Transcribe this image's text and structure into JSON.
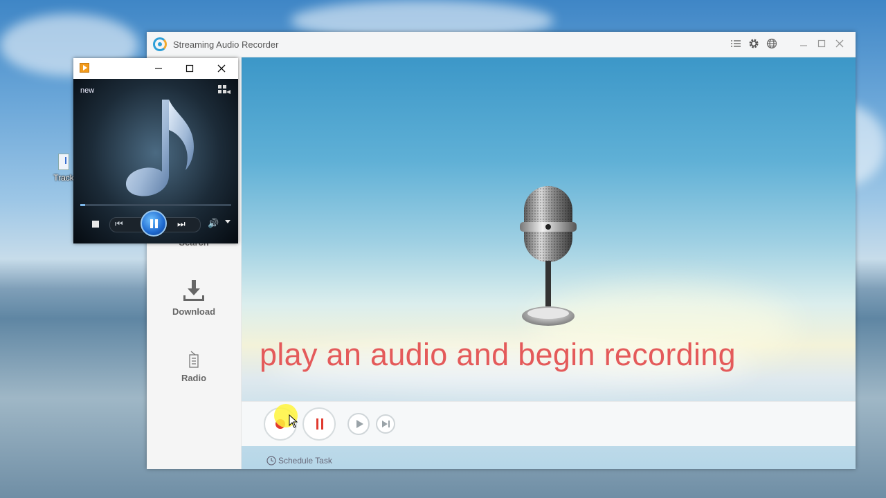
{
  "desktop": {
    "icon_label": "Track"
  },
  "app": {
    "title": "Streaming Audio Recorder",
    "titlebar_icons": [
      "menu-icon",
      "settings-icon",
      "language-icon",
      "minimize-icon",
      "maximize-icon",
      "close-icon"
    ],
    "sidebar": {
      "items": [
        {
          "label": "Search"
        },
        {
          "label": "Download"
        },
        {
          "label": "Radio"
        }
      ]
    },
    "caption": "play an audio and begin recording",
    "schedule_label": "Schedule Task",
    "colors": {
      "caption": "#e45a5a",
      "record": "#e03a2f"
    }
  },
  "player": {
    "now_playing": "new",
    "progress": 0.03
  }
}
